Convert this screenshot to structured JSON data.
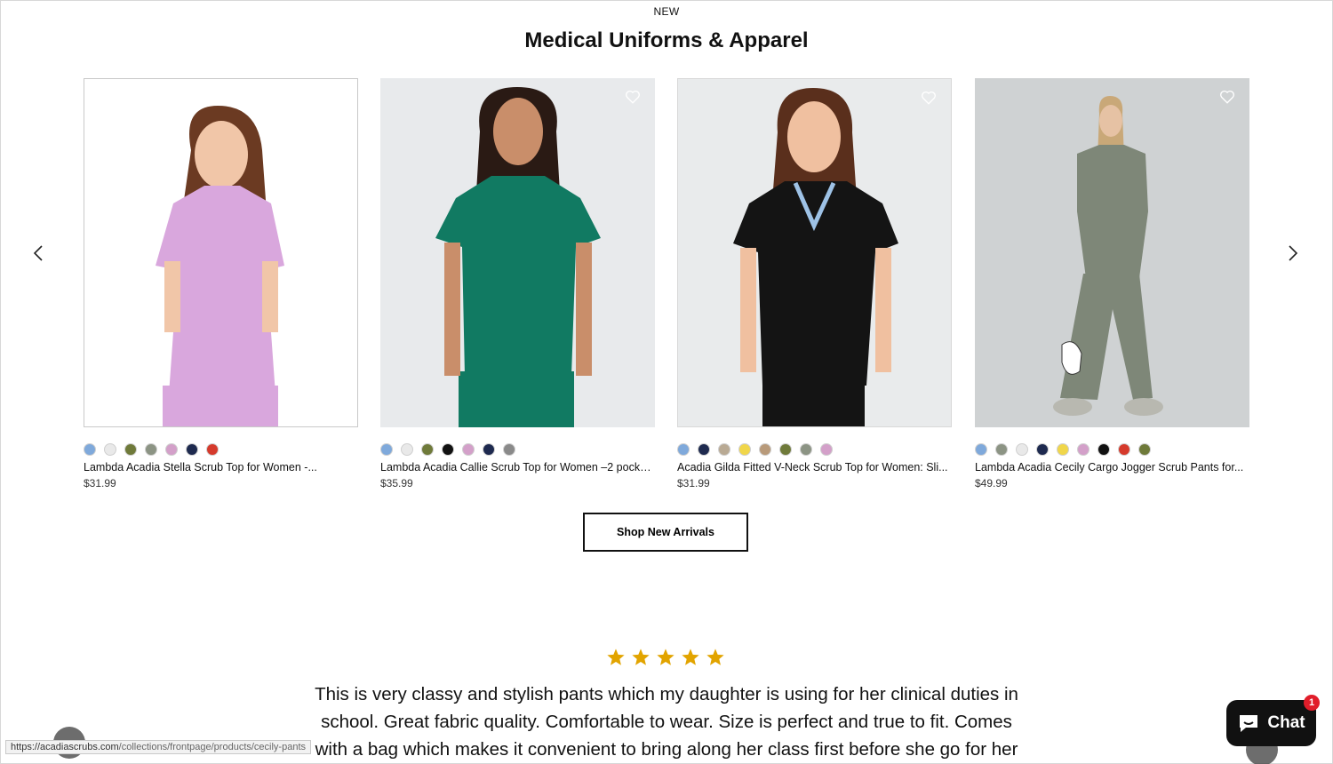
{
  "section": {
    "eyebrow": "NEW",
    "title": "Medical Uniforms & Apparel",
    "button_label": "Shop New Arrivals"
  },
  "products": [
    {
      "name": "Lambda Acadia Stella Scrub Top for Women -...",
      "price": "$31.99",
      "image_bg": "#ffffff",
      "garment_color": "#d9a7dd",
      "wishlist": false,
      "swatches": [
        "#7fa9db",
        "#e9e9e9",
        "#6f7a3a",
        "#8c9484",
        "#d3a0c9",
        "#1e2a4f",
        "#d53a2c"
      ]
    },
    {
      "name": "Lambda Acadia Callie Scrub Top for Women –2 pocket...",
      "price": "$35.99",
      "image_bg": "#e8eaec",
      "garment_color": "#117a62",
      "wishlist": true,
      "swatches": [
        "#7fa9db",
        "#e9e9e9",
        "#6f7a3a",
        "#111111",
        "#d3a0c9",
        "#1e2a4f",
        "#8a8a8a"
      ]
    },
    {
      "name": "Acadia Gilda Fitted V-Neck Scrub Top for Women: Sli...",
      "price": "$31.99",
      "image_bg": "#e9ebec",
      "garment_color": "#141414",
      "wishlist": true,
      "swatches": [
        "#7fa9db",
        "#1e2a4f",
        "#b9aa94",
        "#f0d64a",
        "#b89a7a",
        "#6f7a3a",
        "#8c9484",
        "#d3a0c9"
      ]
    },
    {
      "name": "Lambda Acadia Cecily Cargo Jogger Scrub Pants for...",
      "price": "$49.99",
      "image_bg": "#cfd2d3",
      "garment_color": "#7e8778",
      "wishlist": true,
      "swatches": [
        "#7fa9db",
        "#8c9484",
        "#e9e9e9",
        "#1e2a4f",
        "#f0d64a",
        "#d3a0c9",
        "#111111",
        "#d53a2c",
        "#6f7a3a"
      ]
    }
  ],
  "review": {
    "rating": 5,
    "star_color": "#e2a400",
    "line1": "This is very classy and stylish pants which my daughter is using for her clinical duties in",
    "line2": "school. Great fabric quality. Comfortable to wear. Size is perfect and true to fit. Comes",
    "line3": "with a bag which makes it convenient to bring along her class first before she go for her"
  },
  "status_bar": {
    "url_host": "https://acadiascrubs.com",
    "url_path": "/collections/frontpage/products/cecily-pants"
  },
  "chat_widget": {
    "label": "Chat",
    "badge_count": "1",
    "icon": "chat-bubble-icon"
  },
  "carousel_icons": {
    "prev": "chevron-left-icon",
    "next": "chevron-right-icon"
  }
}
